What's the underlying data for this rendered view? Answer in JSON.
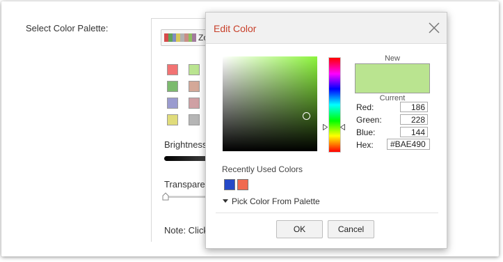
{
  "page": {
    "label": "Select Color Palette:"
  },
  "palette_panel": {
    "selected_palette_text": "Zo",
    "strip_colors": [
      "#d64b4b",
      "#5fa35a",
      "#7f8ac2",
      "#d7c85c",
      "#b2b2b2",
      "#c98e86",
      "#8fbf62",
      "#a27b9d"
    ],
    "swatches_col1": [
      "#f27373",
      "#7cba6e",
      "#9a9bcf",
      "#e0dc7b"
    ],
    "swatches_col2": [
      "#bae490",
      "#d4a898",
      "#cfa0a4",
      "#b5b5b5"
    ],
    "brightness_label": "Brightness",
    "transparency_label": "Transparen",
    "note_label": "Note: Click"
  },
  "dialog": {
    "title": "Edit Color",
    "new_label": "New",
    "current_label": "Current",
    "new_color": "#BAE490",
    "red_label": "Red:",
    "red_value": "186",
    "green_label": "Green:",
    "green_value": "228",
    "blue_label": "Blue:",
    "blue_value": "144",
    "hex_label": "Hex:",
    "hex_value": "#BAE490",
    "recent_label": "Recently Used Colors",
    "recent_colors": [
      "#2549c8",
      "#f06a50"
    ],
    "pick_label": "Pick Color From Palette",
    "ok_label": "OK",
    "cancel_label": "Cancel"
  },
  "colors": {
    "title_accent": "#c8402a",
    "hue_base": "#8cf43c"
  }
}
